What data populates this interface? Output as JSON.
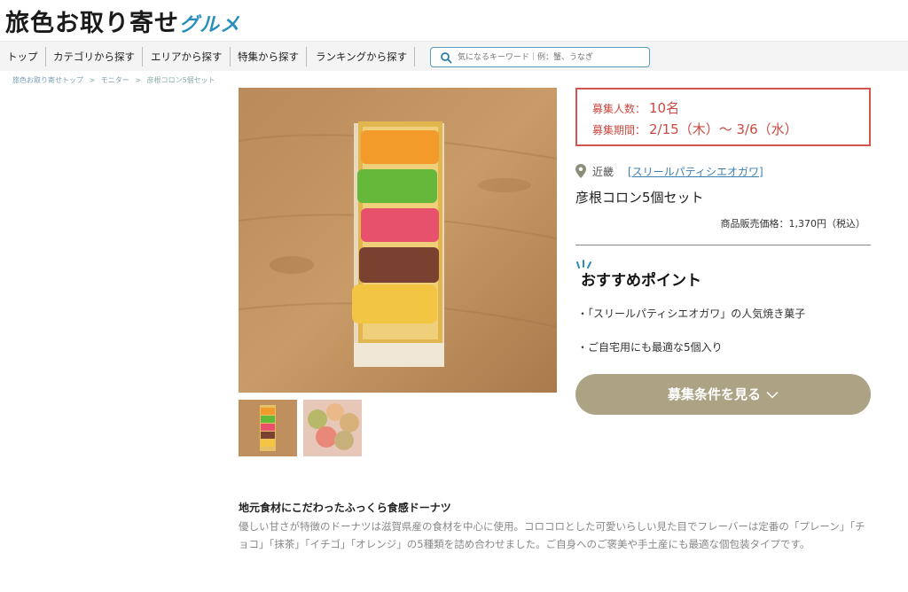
{
  "header": {
    "logo_text_dark": "旅色お取り寄せ",
    "logo_text_blue": "グルメ"
  },
  "nav": {
    "items": [
      {
        "label": "トップ"
      },
      {
        "label": "カテゴリから探す"
      },
      {
        "label": "エリアから探す"
      },
      {
        "label": "特集から探す"
      },
      {
        "label": "ランキングから探す"
      }
    ],
    "search": {
      "placeholder": "気になるキーワード｜例：蟹、うなぎ",
      "icon": "search-icon"
    }
  },
  "breadcrumb": {
    "items": [
      "旅色お取り寄せトップ",
      "モニター",
      "彦根コロン5個セット"
    ],
    "separator": ">"
  },
  "recruit": {
    "count_label": "募集人数：",
    "count_value": "10名",
    "period_label": "募集期間：",
    "period_value": "2/15（木）〜 3/6（水）",
    "accent_color": "#d0574e"
  },
  "product": {
    "region": "近畿",
    "shop": "[スリールパティシエオガワ]",
    "title": "彦根コロン5個セット",
    "price": "商品販売価格：1,370円（税込）"
  },
  "recommend": {
    "title": "おすすめポイント",
    "points": [
      "・「スリールパティシエオガワ」の人気焼き菓子",
      "・ご自宅用にも最適な5個入り"
    ]
  },
  "cta": {
    "label": "募集条件を見る",
    "color": "#aca385"
  },
  "description": {
    "title": "地元食材にこだわったふっくら食感ドーナツ",
    "body": "優しい甘さが特徴のドーナツは滋賀県産の食材を中心に使用。コロコロとした可愛いらしい見た目でフレーバーは定番の「プレーン」「チョコ」「抹茶」「イチゴ」「オレンジ」の5種類を詰め合わせました。ご自身へのご褒美や手土産にも最適な個包装タイプです。"
  }
}
